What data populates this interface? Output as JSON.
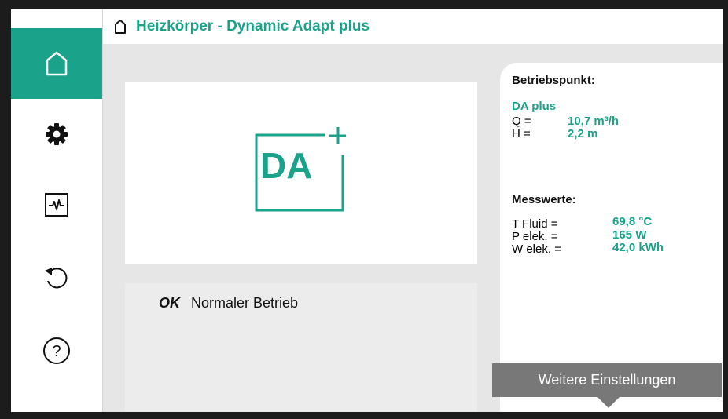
{
  "header": {
    "title": "Heizkörper - Dynamic Adapt plus",
    "icon": "house-icon"
  },
  "sidebar": {
    "items": [
      {
        "icon": "home-icon",
        "active": true
      },
      {
        "icon": "gear-icon",
        "active": false
      },
      {
        "icon": "diagnostics-icon",
        "active": false
      },
      {
        "icon": "undo-icon",
        "active": false
      },
      {
        "icon": "help-icon",
        "active": false
      }
    ]
  },
  "mode": {
    "badge": "DA"
  },
  "status": {
    "code": "OK",
    "text": "Normaler Betrieb"
  },
  "betriebspunkt": {
    "title": "Betriebspunkt:",
    "mode_name": "DA plus",
    "rows": [
      {
        "label": "Q =",
        "value": "10,7 m³/h"
      },
      {
        "label": "H =",
        "value": "2,2 m"
      }
    ]
  },
  "messwerte": {
    "title": "Messwerte:",
    "rows": [
      {
        "label": "T Fluid =",
        "value": "69,8 °C"
      },
      {
        "label": "P elek. =",
        "value": "165 W"
      },
      {
        "label": "W elek. =",
        "value": "42,0 kWh"
      }
    ]
  },
  "more_button": {
    "label": "Weitere Einstellungen"
  },
  "colors": {
    "accent": "#1aa28b",
    "button": "#787878",
    "background": "#e6e6e6"
  }
}
